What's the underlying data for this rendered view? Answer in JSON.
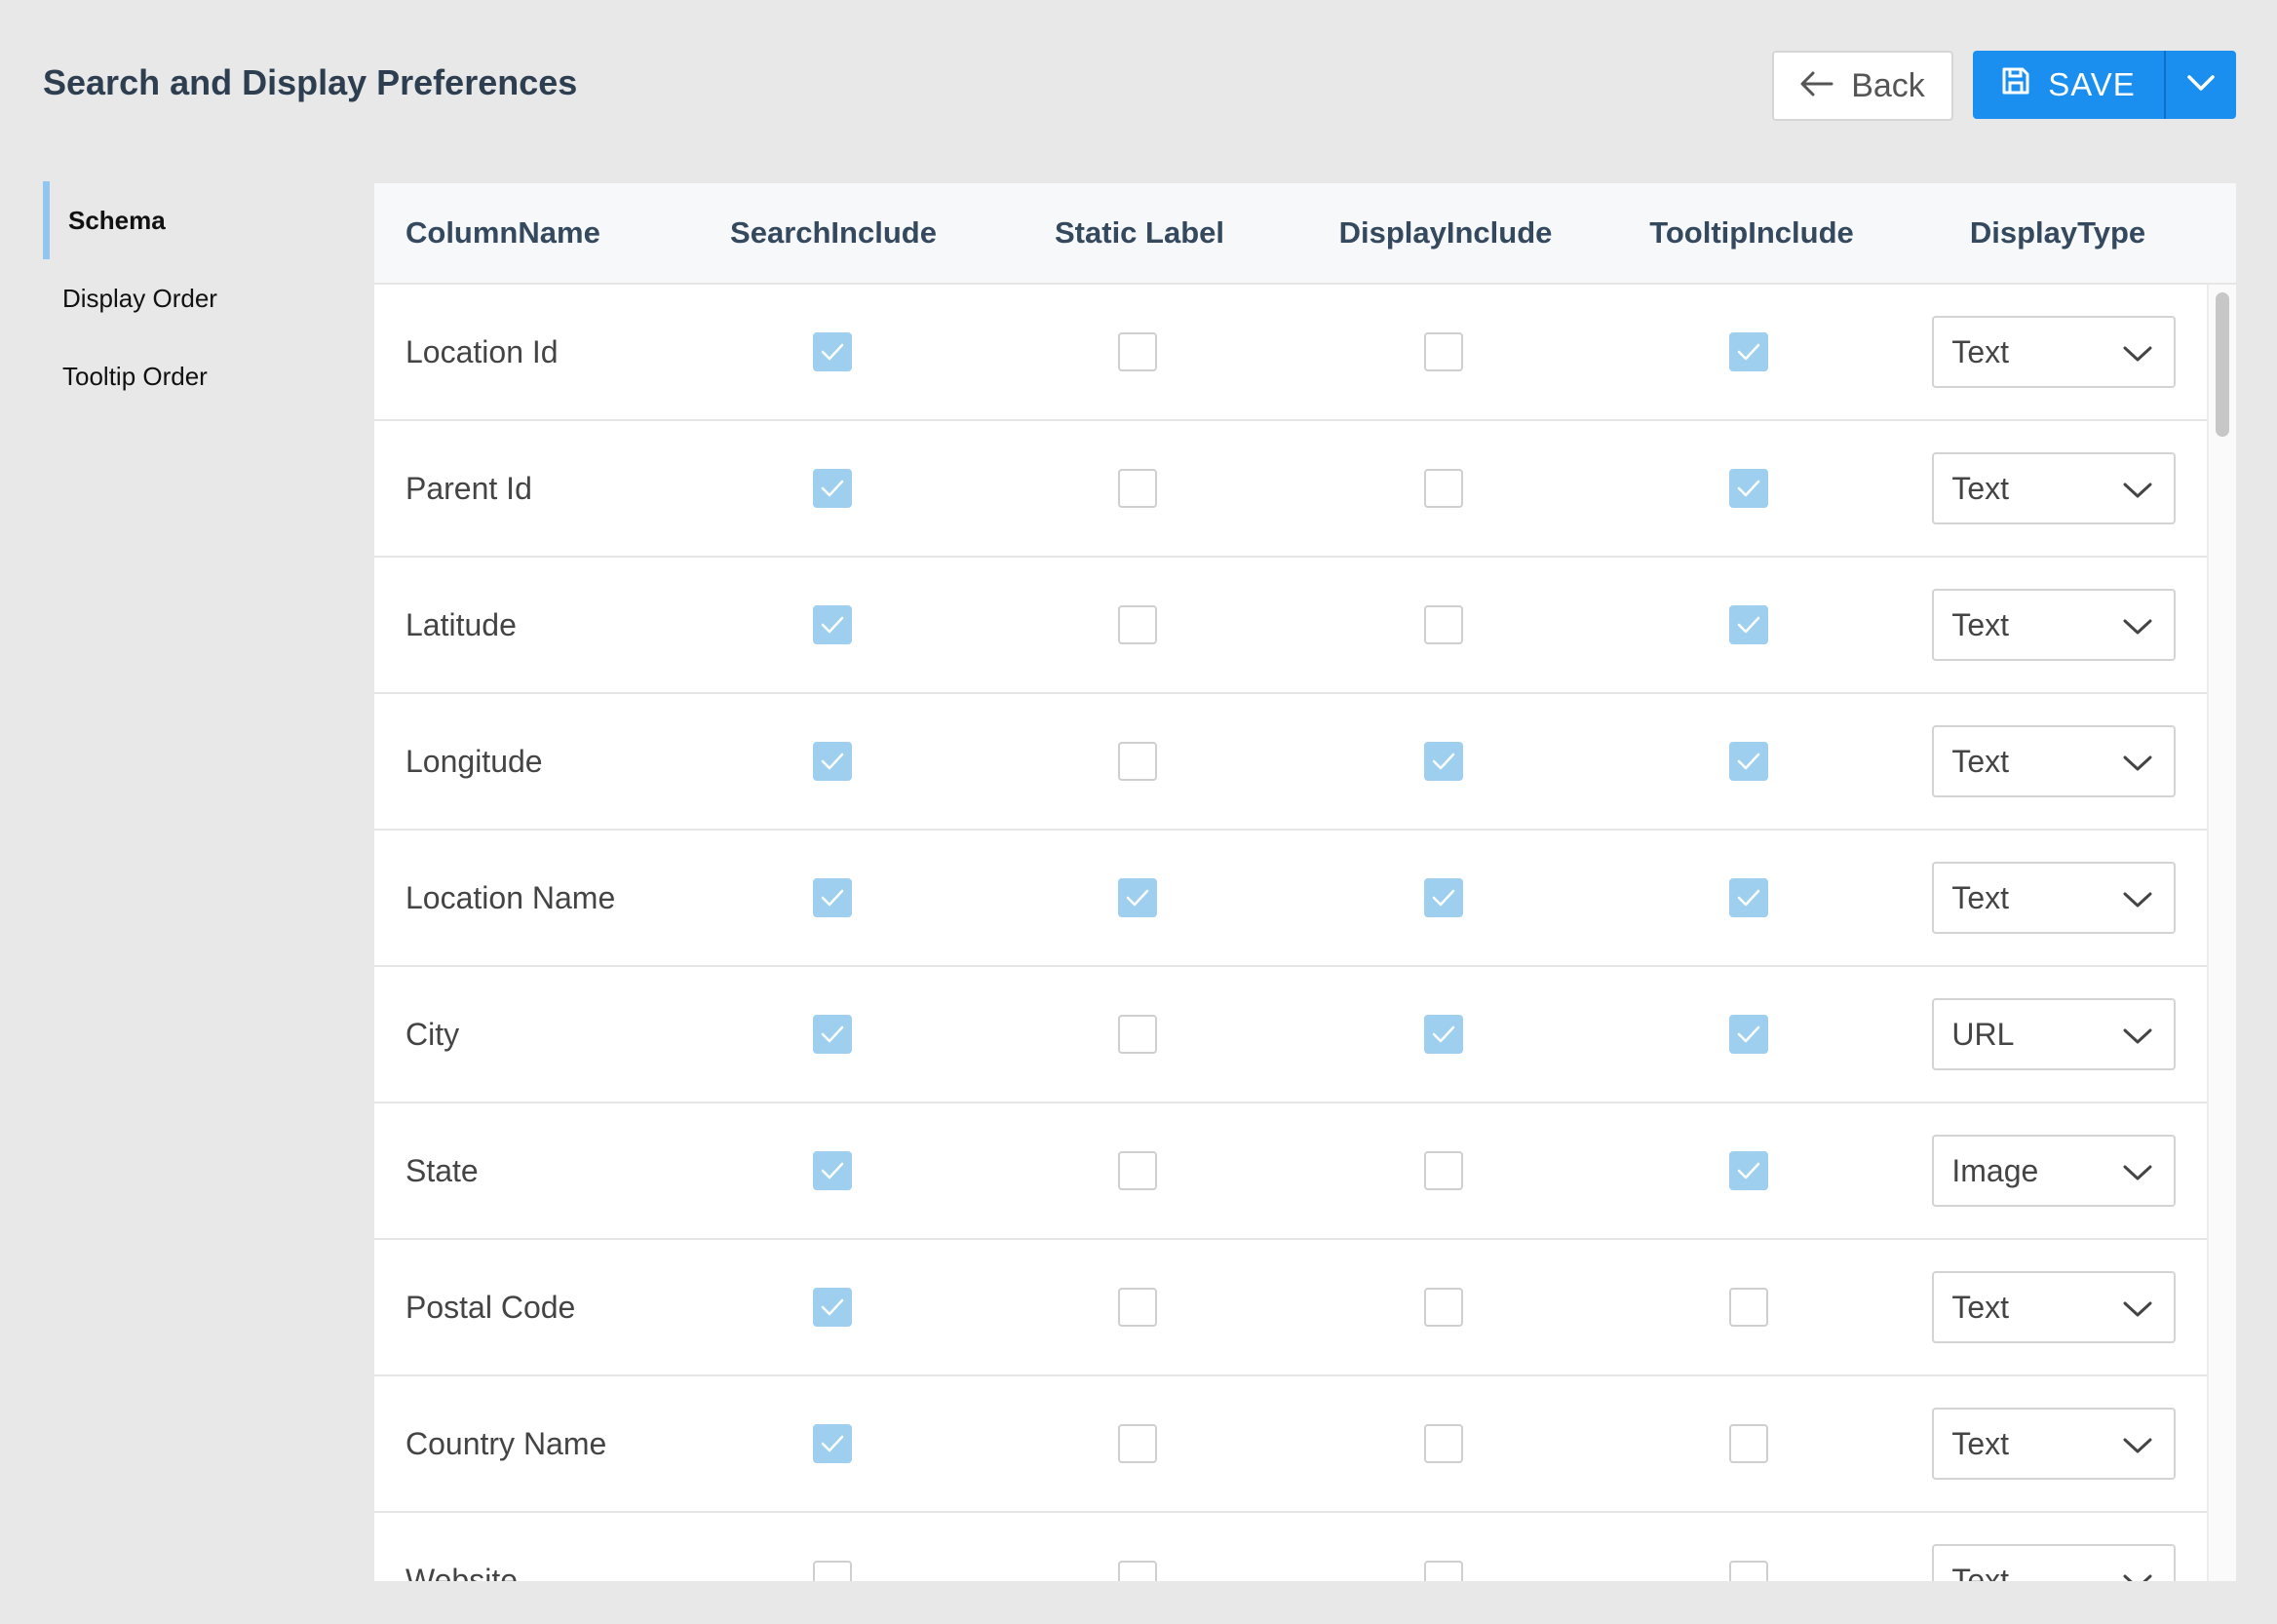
{
  "header": {
    "title": "Search and Display Preferences",
    "back_label": "Back",
    "save_label": "SAVE"
  },
  "sidebar": {
    "items": [
      {
        "label": "Schema",
        "active": true
      },
      {
        "label": "Display Order",
        "active": false
      },
      {
        "label": "Tooltip Order",
        "active": false
      }
    ]
  },
  "table": {
    "columns": [
      "ColumnName",
      "SearchInclude",
      "Static Label",
      "DisplayInclude",
      "TooltipInclude",
      "DisplayType"
    ],
    "rows": [
      {
        "name": "Location Id",
        "search": true,
        "static": false,
        "display": false,
        "tooltip": true,
        "type": "Text"
      },
      {
        "name": "Parent Id",
        "search": true,
        "static": false,
        "display": false,
        "tooltip": true,
        "type": "Text"
      },
      {
        "name": "Latitude",
        "search": true,
        "static": false,
        "display": false,
        "tooltip": true,
        "type": "Text"
      },
      {
        "name": "Longitude",
        "search": true,
        "static": false,
        "display": true,
        "tooltip": true,
        "type": "Text"
      },
      {
        "name": "Location Name",
        "search": true,
        "static": true,
        "display": true,
        "tooltip": true,
        "type": "Text"
      },
      {
        "name": "City",
        "search": true,
        "static": false,
        "display": true,
        "tooltip": true,
        "type": "URL"
      },
      {
        "name": "State",
        "search": true,
        "static": false,
        "display": false,
        "tooltip": true,
        "type": "Image"
      },
      {
        "name": "Postal Code",
        "search": true,
        "static": false,
        "display": false,
        "tooltip": false,
        "type": "Text"
      },
      {
        "name": "Country Name",
        "search": true,
        "static": false,
        "display": false,
        "tooltip": false,
        "type": "Text"
      },
      {
        "name": "Website",
        "search": false,
        "static": false,
        "display": false,
        "tooltip": false,
        "type": "Text"
      }
    ]
  },
  "colors": {
    "accent": "#1a8ff0",
    "checkbox_checked": "#9ecfef",
    "sidebar_active_bar": "#8fc7f2"
  },
  "icons": {
    "back": "arrow-left-icon",
    "save": "floppy-disk-icon",
    "split": "chevron-down-icon",
    "select": "chevron-down-icon",
    "checkbox": "checkmark-icon"
  }
}
